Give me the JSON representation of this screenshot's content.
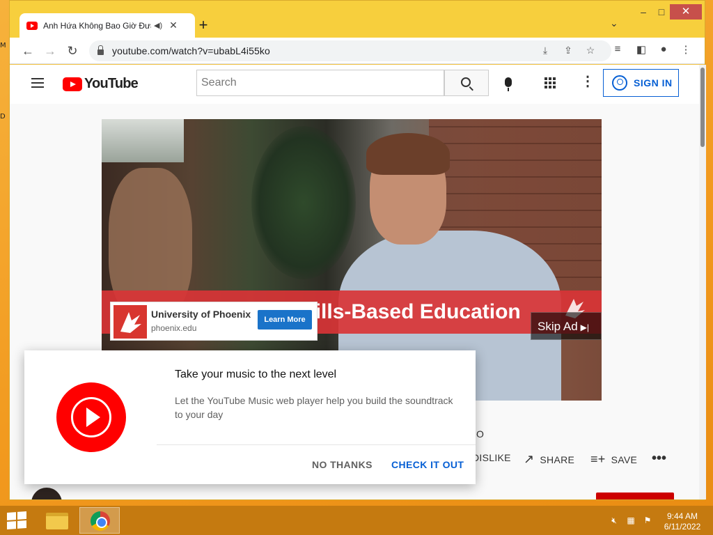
{
  "desktop": {
    "marks": [
      "M",
      "D"
    ]
  },
  "browser": {
    "tab": {
      "title": "Anh Hứa Không Bao Giờ Đưa",
      "audio_icon": "speaker-icon",
      "close_glyph": "✕"
    },
    "new_tab_glyph": "+",
    "tab_search_glyph": "⌄",
    "window_controls": {
      "minimize": "–",
      "maximize": "□",
      "close": "✕"
    },
    "nav": {
      "back": "←",
      "forward": "→",
      "reload": "↻"
    },
    "url": "youtube.com/watch?v=ubabL4i55ko",
    "omnibox_icons": [
      "install-icon",
      "share-icon",
      "star-icon"
    ],
    "toolbar_icons": [
      "media-icon",
      "sidepanel-icon",
      "profile-icon",
      "menu-icon"
    ]
  },
  "youtube": {
    "logo_text": "YouTube",
    "search_placeholder": "Search",
    "sign_in_label": "SIGN IN",
    "more_glyph": "⋮"
  },
  "ad": {
    "banner_text": "Skills-Based Education",
    "advertiser": "University of Phoenix",
    "domain": "phoenix.edu",
    "cta": "Learn More",
    "skip_label": "Skip Ad",
    "skip_glyph": "▶|"
  },
  "below_video": {
    "title_fragment": "O",
    "dislike_label": "DISLIKE",
    "share_label": "SHARE",
    "save_label": "SAVE",
    "more_glyph": "•••"
  },
  "promo": {
    "title": "Take your music to the next level",
    "body": "Let the YouTube Music web player help you build the soundtrack to your day",
    "dismiss_label": "NO THANKS",
    "accept_label": "CHECK IT OUT"
  },
  "taskbar": {
    "time": "9:44 AM",
    "date": "6/11/2022",
    "tray_icons": [
      "volume-muted-icon",
      "network-icon",
      "action-center-icon"
    ]
  },
  "colors": {
    "youtube_red": "#ff0000",
    "link_blue": "#065fd4",
    "desktop_orange": "#f29a1f"
  }
}
